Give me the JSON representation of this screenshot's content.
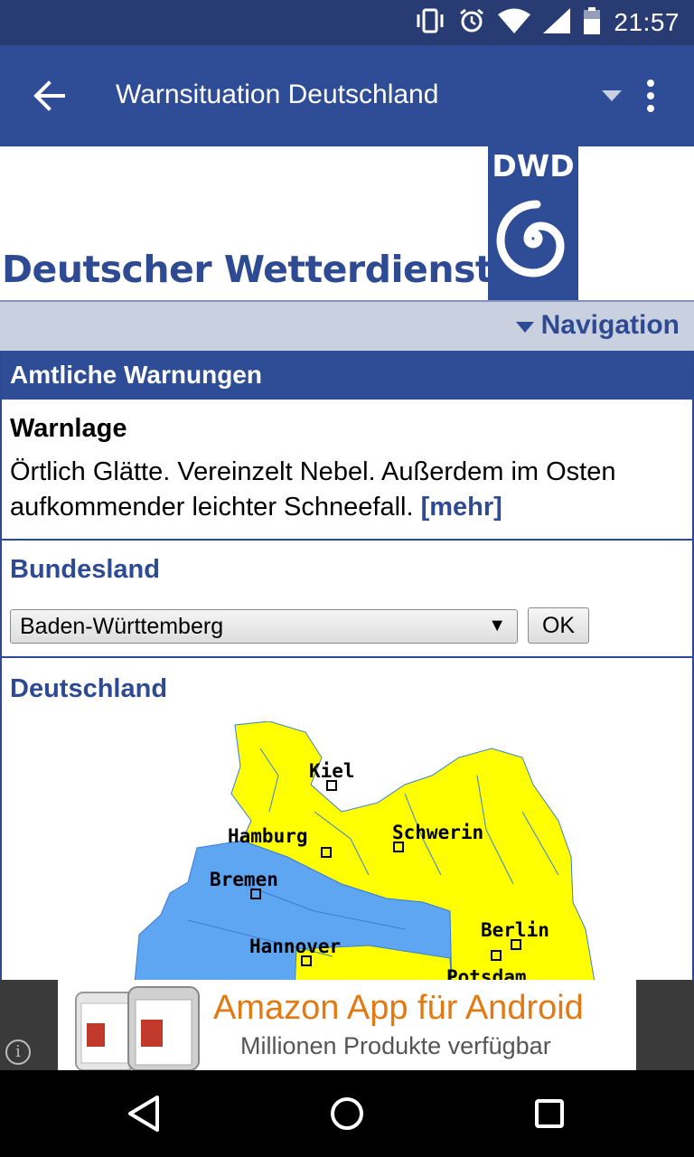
{
  "status_bar": {
    "time": "21:57",
    "icons": [
      "vibrate-icon",
      "alarm-icon",
      "wifi-icon",
      "signal-icon",
      "battery-icon"
    ]
  },
  "app_bar": {
    "title": "Warnsituation Deutschland"
  },
  "banner": {
    "wordmark": "Deutscher Wetterdienst",
    "logo_text": "DWD"
  },
  "nav": {
    "label": "Navigation"
  },
  "section": {
    "title": "Amtliche Warnungen"
  },
  "warnlage": {
    "heading": "Warnlage",
    "text": "Örtlich Glätte. Vereinzelt Nebel. Außerdem im Osten aufkommender leichter Schneefall.",
    "more_link": "[mehr]"
  },
  "bundesland": {
    "heading": "Bundesland",
    "selected": "Baden-Württemberg",
    "ok_label": "OK"
  },
  "deutschland": {
    "heading": "Deutschland",
    "cities": [
      "Kiel",
      "Hamburg",
      "Schwerin",
      "Bremen",
      "Berlin",
      "Hannover",
      "Potsdam"
    ]
  },
  "ad": {
    "headline": "Amazon App für Android",
    "subline": "Millionen Produkte verfügbar"
  },
  "colors": {
    "brand": "#2f4d96",
    "status_bar": "#283c73",
    "warning_yellow": "#ffff00",
    "map_blue": "#5ea6f2",
    "ad_orange": "#e47911"
  }
}
